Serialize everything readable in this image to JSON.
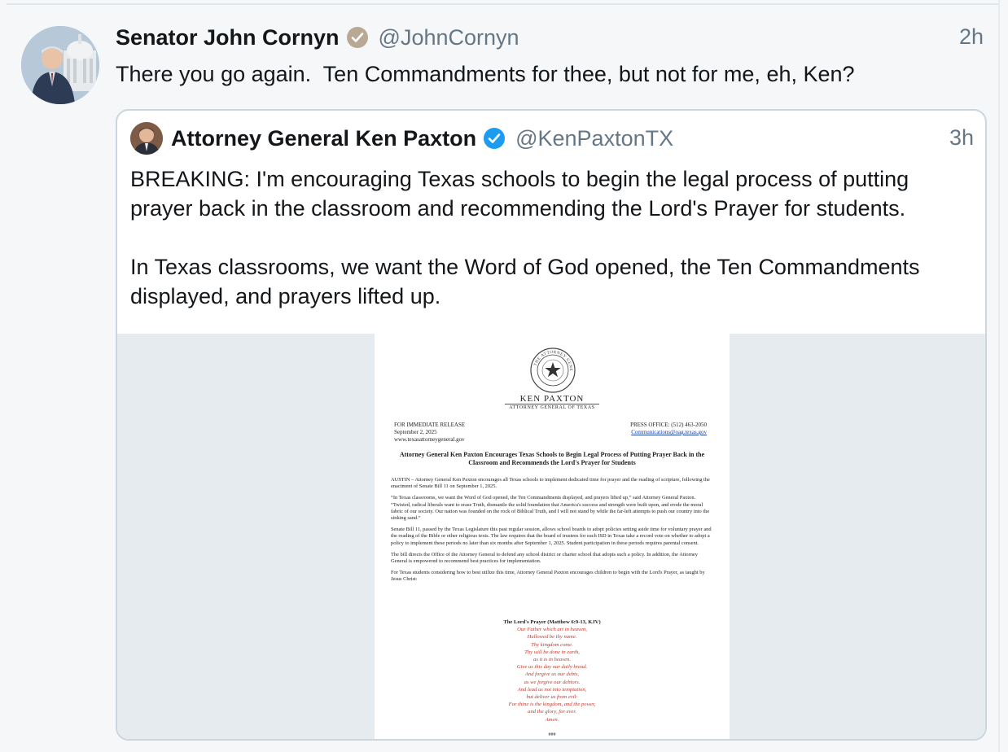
{
  "tweet": {
    "author_name": "Senator John Cornyn",
    "handle": "@JohnCornyn",
    "time": "2h",
    "text": "There you go again.  Ten Commandments for thee, but not for me, eh, Ken?",
    "avatar_icon": "person-photo-capitol",
    "badge_icon": "verified-gray-check-icon"
  },
  "quote": {
    "author_name": "Attorney General Ken Paxton",
    "handle": "@KenPaxtonTX",
    "time": "3h",
    "avatar_icon": "person-photo",
    "badge_icon": "verified-blue-check-icon",
    "paragraphs": [
      "BREAKING: I'm encouraging Texas schools to begin the legal process of putting prayer back in the classroom and recommending the Lord's Prayer for students.",
      "In Texas classrooms, we want the Word of God opened, the Ten Commandments displayed, and prayers lifted up."
    ]
  },
  "document": {
    "seal_text": "THE ATTORNEY GENERAL · OF TEXAS",
    "name": "KEN PAXTON",
    "subtitle": "ATTORNEY GENERAL OF TEXAS",
    "release": [
      "FOR IMMEDIATE RELEASE",
      "September 2, 2025",
      "www.texasattorneygeneral.gov"
    ],
    "press_office": "PRESS OFFICE: (512) 463-2050",
    "press_email": "Communications@oag.texas.gov",
    "title": "Attorney General Ken Paxton Encourages Texas Schools to Begin Legal Process of Putting Prayer Back in the Classroom and Recommends the Lord's Prayer for Students",
    "paragraphs": [
      "AUSTIN – Attorney General Ken Paxton encourages all Texas schools to implement dedicated time for prayer and the reading of scripture, following the enactment of Senate Bill 11 on September 1, 2025.",
      "“In Texas classrooms, we want the Word of God opened, the Ten Commandments displayed, and prayers lifted up,” said Attorney General Paxton. “Twisted, radical liberals want to erase Truth, dismantle the solid foundation that America's success and strength were built upon, and erode the moral fabric of our society. Our nation was founded on the rock of Biblical Truth, and I will not stand by while the far-left attempts to push our country into the sinking sand.”",
      "Senate Bill 11, passed by the Texas Legislature this past regular session, allows school boards to adopt policies setting aside time for voluntary prayer and the reading of the Bible or other religious texts. The law requires that the board of trustees for each ISD in Texas take a record vote on whether to adopt a policy to implement these periods no later than six months after September 1, 2025. Student participation in these periods requires parental consent.",
      "The bill directs the Office of the Attorney General to defend any school district or charter school that adopts such a policy. In addition, the Attorney General is empowered to recommend best practices for implementation.",
      "For Texas students considering how to best utilize this time, Attorney General Paxton encourages children to begin with the Lord's Prayer, as taught by Jesus Christ:"
    ],
    "prayer_title": "The Lord's Prayer (Matthew 6:9-13, KJV)",
    "prayer_lines": [
      "Our Father which art in heaven,",
      "Hallowed be thy name.",
      "Thy kingdom come.",
      "Thy will be done in earth,",
      "as it is in heaven.",
      "Give us this day our daily bread.",
      "And forgive us our debts,",
      "as we forgive our debtors.",
      "And lead us not into temptation,",
      "but deliver us from evil:",
      "For thine is the kingdom, and the power,",
      "and the glory, for ever.",
      "Amen."
    ],
    "end_mark": "###"
  },
  "colors": {
    "handle_gray": "#657786",
    "border": "#ccd6dd",
    "verified_blue": "#1d9bf0",
    "verified_gray": "#b9a994",
    "prayer_red": "#c0392b",
    "media_bg": "#e6ebef"
  }
}
